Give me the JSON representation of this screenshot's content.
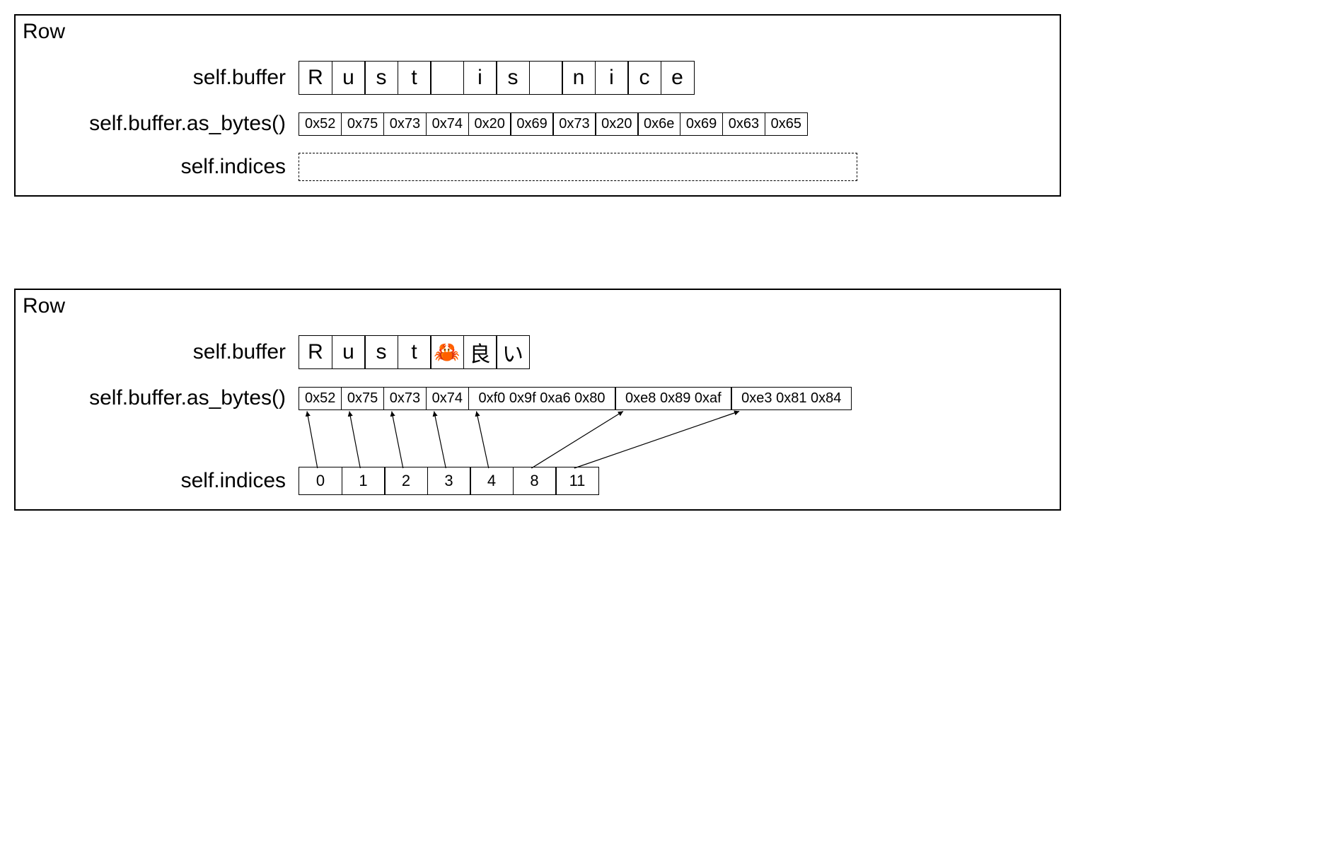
{
  "diagram1": {
    "title": "Row",
    "labels": {
      "buffer": "self.buffer",
      "bytes": "self.buffer.as_bytes()",
      "indices": "self.indices"
    },
    "buffer_chars": [
      "R",
      "u",
      "s",
      "t",
      " ",
      "i",
      "s",
      " ",
      "n",
      "i",
      "c",
      "e"
    ],
    "bytes": [
      "0x52",
      "0x75",
      "0x73",
      "0x74",
      "0x20",
      "0x69",
      "0x73",
      "0x20",
      "0x6e",
      "0x69",
      "0x63",
      "0x65"
    ],
    "indices": []
  },
  "diagram2": {
    "title": "Row",
    "labels": {
      "buffer": "self.buffer",
      "bytes": "self.buffer.as_bytes()",
      "indices": "self.indices"
    },
    "buffer_chars": [
      "R",
      "u",
      "s",
      "t",
      "🦀",
      "良",
      "い"
    ],
    "byte_groups": [
      [
        "0x52"
      ],
      [
        "0x75"
      ],
      [
        "0x73"
      ],
      [
        "0x74"
      ],
      [
        "0xf0",
        "0x9f",
        "0xa6",
        "0x80"
      ],
      [
        "0xe8",
        "0x89",
        "0xaf"
      ],
      [
        "0xe3",
        "0x81",
        "0x84"
      ]
    ],
    "indices": [
      0,
      1,
      2,
      3,
      4,
      8,
      11
    ]
  }
}
